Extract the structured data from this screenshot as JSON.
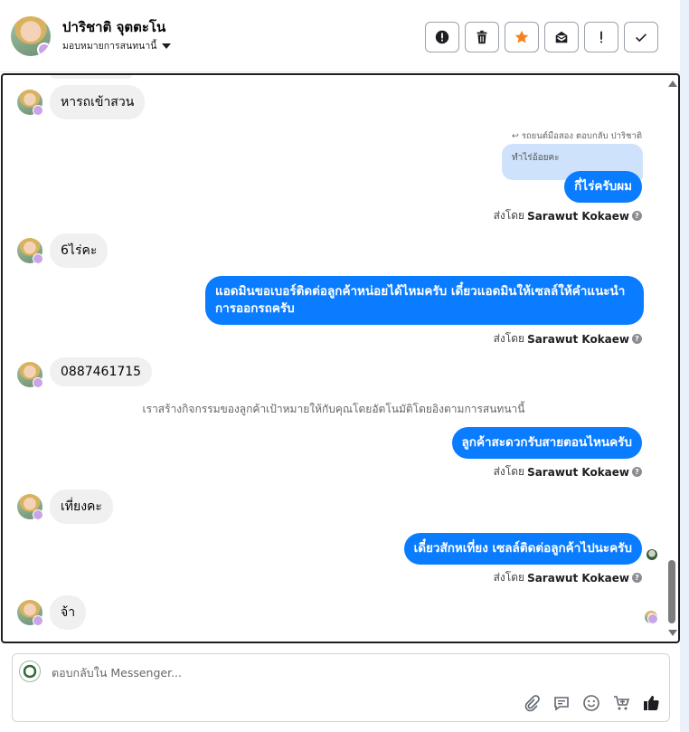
{
  "header": {
    "name": "ปาริชาติ จุตตะโน",
    "assign_label": "มอบหมายการสนทนานี้"
  },
  "actions": [
    {
      "name": "mark-spam-button",
      "icon": "alert-circle-icon"
    },
    {
      "name": "delete-button",
      "icon": "trash-icon"
    },
    {
      "name": "star-button",
      "icon": "star-icon",
      "color": "#f5821f"
    },
    {
      "name": "mark-unread-button",
      "icon": "envelope-icon"
    },
    {
      "name": "follow-up-button",
      "icon": "exclamation-icon"
    },
    {
      "name": "mark-done-button",
      "icon": "check-icon"
    }
  ],
  "messages": {
    "m1": "หารถเข้าสวน",
    "reply_meta": "รถยนต์มือสอง ตอบกลับ ปาริชาติ",
    "quoted": "ทำไร่อ้อยคะ",
    "m2": "กี่ไร่ครับผม",
    "m3": "6ไร่คะ",
    "m4": "แอดมินขอเบอร์ติดต่อลูกค้าหน่อยได้ไหมครับ เดี๋ยวแอดมินให้เซลล์ให้คำแนะนำการออกรถครับ",
    "m5": "0887461715",
    "system_note": "เราสร้างกิจกรรมของลูกค้าเป้าหมายให้กับคุณโดยอัตโนมัติโดยอิงตามการสนทนานี้",
    "m6": "ลูกค้าสะดวกรับสายตอนไหนครับ",
    "m7": "เที่ยงคะ",
    "m8": "เดี๋ยวสักหเที่ยง เซลล์ติดต่อลูกค้าไปนะครับ",
    "m9": "จ้า"
  },
  "sent_by": {
    "prefix": "ส่งโดย",
    "agent": "Sarawut Kokaew"
  },
  "composer": {
    "placeholder": "ตอบกลับใน Messenger..."
  },
  "colors": {
    "outgoing_bubble": "#0a7cff",
    "incoming_bubble": "#f0f0f0",
    "quote_bubble": "#cfe2fb"
  }
}
